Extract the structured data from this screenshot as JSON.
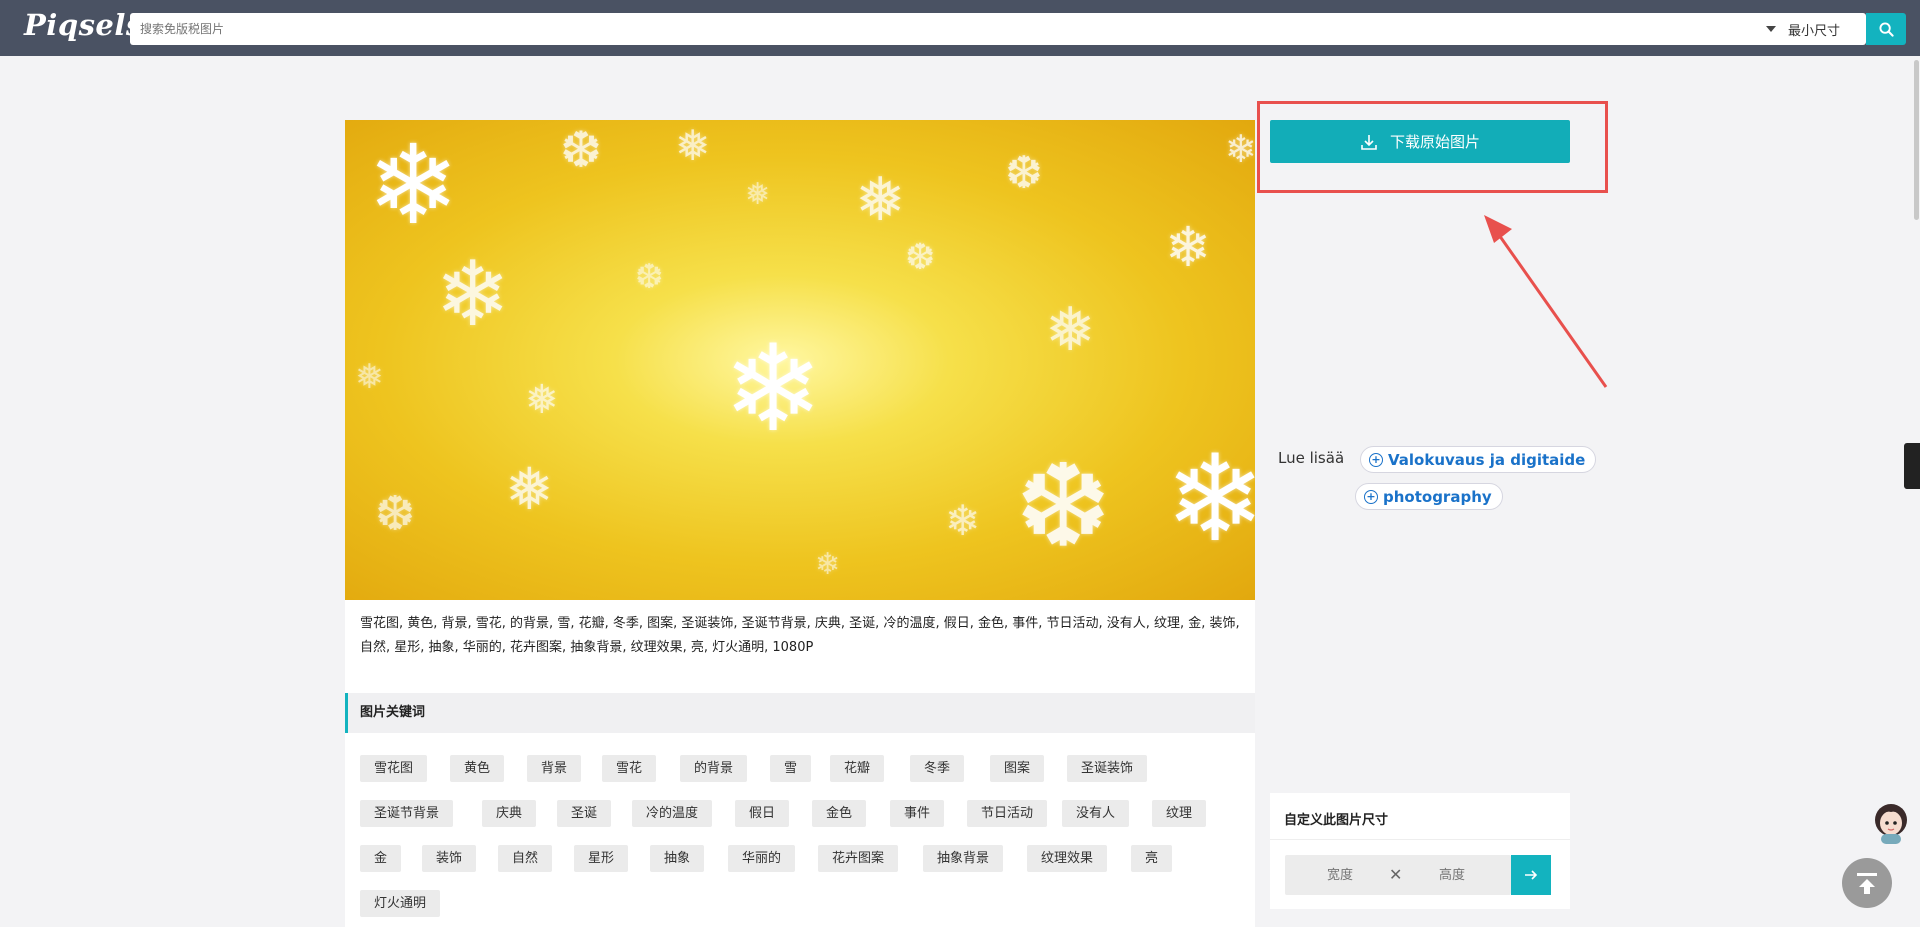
{
  "header": {
    "logo": "Piqsels",
    "search_placeholder": "搜索免版税图片",
    "size_select": "最小尺寸"
  },
  "photo": {
    "subject": "yellow snowflake christmas background"
  },
  "description": "雪花图, 黄色, 背景, 雪花, 的背景, 雪, 花瓣, 冬季, 图案, 圣诞装饰, 圣诞节背景, 庆典, 圣诞, 冷的温度, 假日, 金色, 事件, 节日活动, 没有人, 纹理, 金, 装饰, 自然, 星形, 抽象, 华丽的, 花卉图案, 抽象背景, 纹理效果, 亮, 灯火通明, 1080P",
  "keywords_heading": "图片关键词",
  "keywords": [
    [
      "雪花图",
      "黄色",
      "背景",
      "雪花",
      "的背景",
      "雪",
      "花瓣",
      "冬季",
      "图案",
      "圣诞装饰"
    ],
    [
      "圣诞节背景",
      "庆典",
      "圣诞",
      "冷的温度",
      "假日",
      "金色",
      "事件",
      "节日活动",
      "没有人",
      "纹理"
    ],
    [
      "金",
      "装饰",
      "自然",
      "星形",
      "抽象",
      "华丽的",
      "花卉图案",
      "抽象背景",
      "纹理效果",
      "亮"
    ],
    [
      "灯火通明"
    ]
  ],
  "download_button": "下载原始图片",
  "read_more": {
    "label": "Lue lisää",
    "links": [
      "Valokuvaus ja digitaide",
      "photography"
    ]
  },
  "custom_size": {
    "title": "自定义此图片尺寸",
    "width_placeholder": "宽度",
    "separator": "✕",
    "height_placeholder": "高度",
    "go_icon": "arrow-right-icon"
  },
  "colors": {
    "topbar": "#4a5263",
    "accent": "#13b3bf",
    "highlight": "#e8504d",
    "link": "#1a72c9"
  }
}
